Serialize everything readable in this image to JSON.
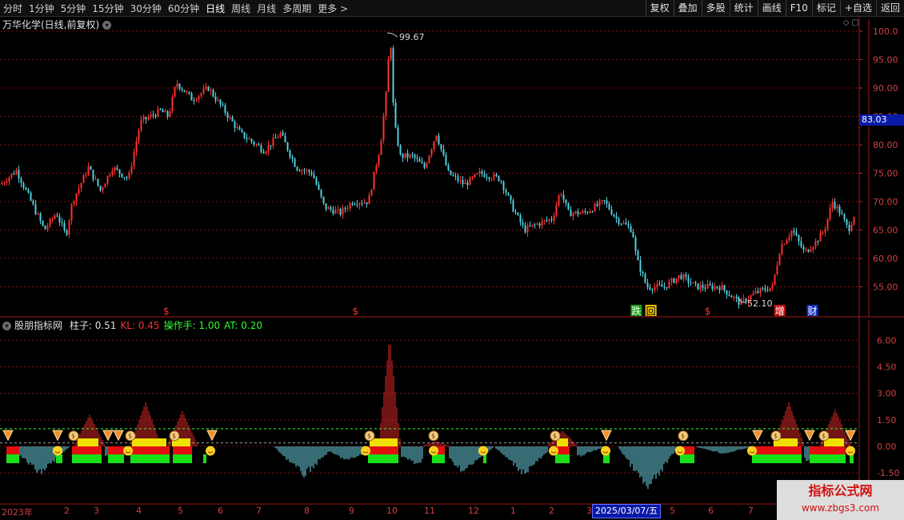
{
  "toolbar": {
    "periods": [
      "分时",
      "1分钟",
      "5分钟",
      "15分钟",
      "30分钟",
      "60分钟",
      "日线",
      "周线",
      "月线",
      "多周期",
      "更多 >"
    ],
    "active_period": "日线",
    "right_buttons": [
      "复权",
      "叠加",
      "多股",
      "统计",
      "画线",
      "F10",
      "标记",
      "+自选",
      "返回"
    ]
  },
  "main_chart": {
    "title": "万华化学(日线,前复权)",
    "y_ticks": [
      "100.0",
      "95.00",
      "90.00",
      "85.00",
      "80.00",
      "75.00",
      "70.00",
      "65.00",
      "60.00",
      "55.00"
    ],
    "y_values": [
      100,
      95,
      90,
      85,
      80,
      75,
      70,
      65,
      60,
      55
    ],
    "current_price": "83.03",
    "high_label": "99.67",
    "low_label": "52.10",
    "markers": [
      {
        "text": "$",
        "x_frac": 0.19,
        "color": "#ff3030"
      },
      {
        "text": "$",
        "x_frac": 0.41,
        "color": "#ff3030"
      },
      {
        "text": "跌",
        "x_frac": 0.735,
        "color": "#ffffff",
        "bg": "#10a010"
      },
      {
        "text": "回",
        "x_frac": 0.752,
        "color": "#000000",
        "bg": "#f0c000"
      },
      {
        "text": "$",
        "x_frac": 0.82,
        "color": "#ff3030"
      },
      {
        "text": "增",
        "x_frac": 0.902,
        "color": "#ffffff",
        "bg": "#c01010"
      },
      {
        "text": "财",
        "x_frac": 0.94,
        "color": "#ffffff",
        "bg": "#1030c0"
      }
    ]
  },
  "indicator": {
    "name": "股朋指标网",
    "items": [
      {
        "label": "柱子:",
        "value": "0.51",
        "color": "#e0e0e0"
      },
      {
        "label": "KL:",
        "value": "0.45",
        "color": "#ff3030"
      },
      {
        "label": "操作手:",
        "value": "1.00",
        "color": "#30ff30"
      },
      {
        "label": "AT:",
        "value": "0.20",
        "color": "#30ff30"
      }
    ],
    "y_ticks": [
      "6.00",
      "4.50",
      "3.00",
      "1.50",
      "0.00",
      "-1.50"
    ],
    "y_values": [
      6,
      4.5,
      3,
      1.5,
      0,
      -1.5
    ]
  },
  "date_axis": {
    "labels": [
      "2023年",
      "2",
      "3",
      "4",
      "5",
      "6",
      "7",
      "8",
      "9",
      "10",
      "11",
      "12",
      "1",
      "2",
      "3",
      "5",
      "6",
      "7"
    ],
    "highlight": "2025/03/07/五"
  },
  "watermark": {
    "line1": "指标公式网",
    "line2": "www.zbgs3.com"
  },
  "colors": {
    "up": "#ff3030",
    "down": "#50d0e0",
    "grid": "#7a1010",
    "axis": "#d04040"
  }
}
